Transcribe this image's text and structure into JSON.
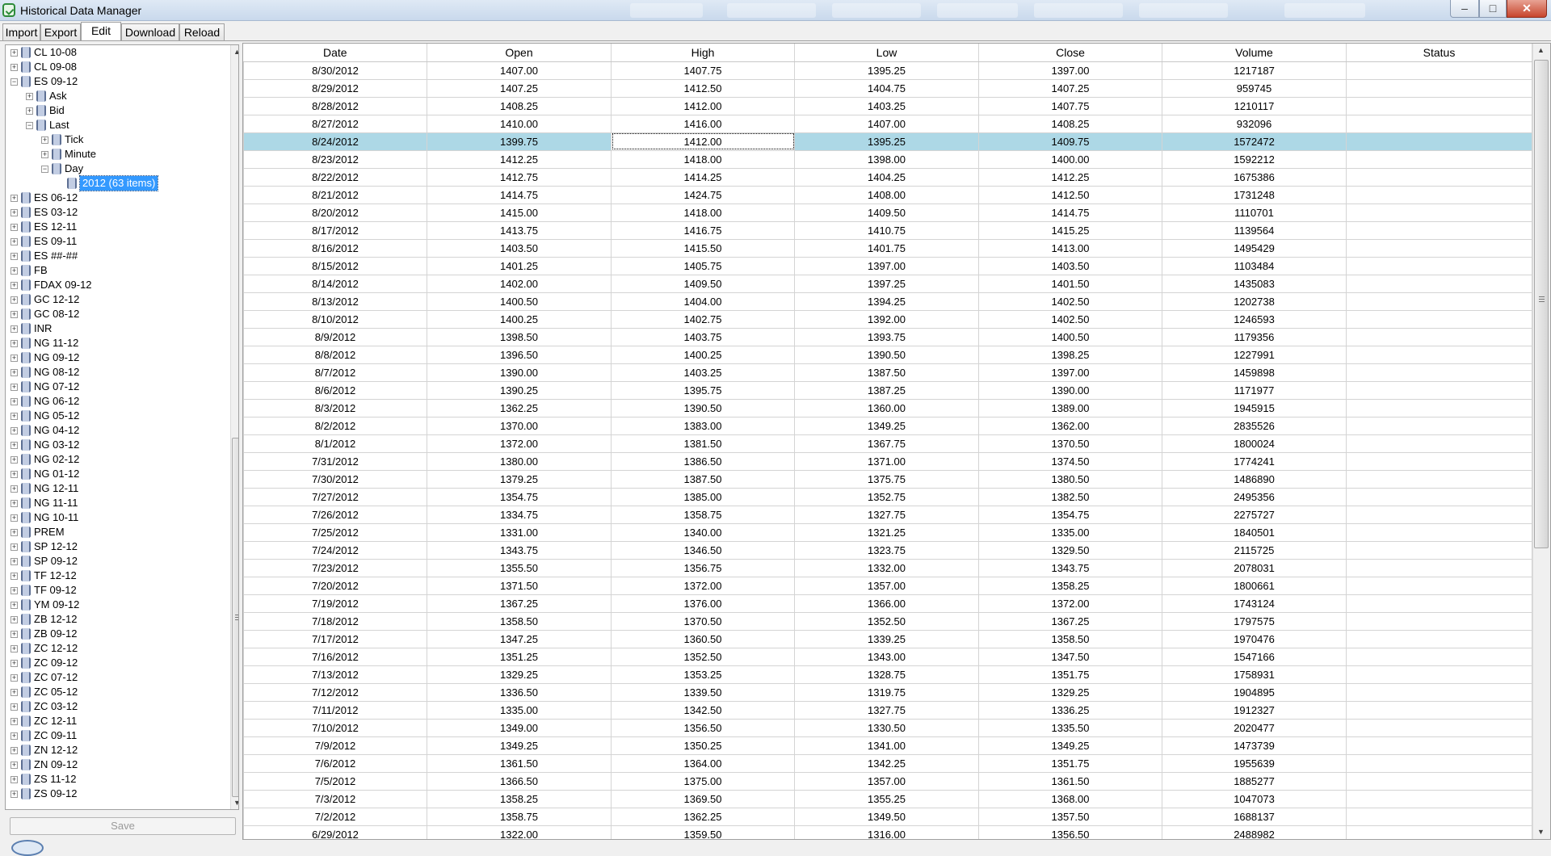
{
  "window": {
    "title": "Historical Data Manager",
    "min_glyph": "–",
    "max_glyph": "□",
    "close_glyph": "✕",
    "app_icon": "database-check-icon"
  },
  "tabs": [
    "Import",
    "Export",
    "Edit",
    "Download",
    "Reload"
  ],
  "active_tab": "Edit",
  "tree": {
    "rows": [
      {
        "label": "CL 10-08",
        "level": 0,
        "expander": "+"
      },
      {
        "label": "CL 09-08",
        "level": 0,
        "expander": "+"
      },
      {
        "label": "ES 09-12",
        "level": 0,
        "expander": "−"
      },
      {
        "label": "Ask",
        "level": 1,
        "expander": "+"
      },
      {
        "label": "Bid",
        "level": 1,
        "expander": "+"
      },
      {
        "label": "Last",
        "level": 1,
        "expander": "−"
      },
      {
        "label": "Tick",
        "level": 2,
        "expander": "+"
      },
      {
        "label": "Minute",
        "level": 2,
        "expander": "+"
      },
      {
        "label": "Day",
        "level": 2,
        "expander": "−"
      },
      {
        "label": "2012 (63 items)",
        "level": 3,
        "expander": "",
        "selected": true
      },
      {
        "label": "ES 06-12",
        "level": 0,
        "expander": "+"
      },
      {
        "label": "ES 03-12",
        "level": 0,
        "expander": "+"
      },
      {
        "label": "ES 12-11",
        "level": 0,
        "expander": "+"
      },
      {
        "label": "ES 09-11",
        "level": 0,
        "expander": "+"
      },
      {
        "label": "ES ##-##",
        "level": 0,
        "expander": "+"
      },
      {
        "label": "FB",
        "level": 0,
        "expander": "+"
      },
      {
        "label": "FDAX 09-12",
        "level": 0,
        "expander": "+"
      },
      {
        "label": "GC 12-12",
        "level": 0,
        "expander": "+"
      },
      {
        "label": "GC 08-12",
        "level": 0,
        "expander": "+"
      },
      {
        "label": "INR",
        "level": 0,
        "expander": "+"
      },
      {
        "label": "NG 11-12",
        "level": 0,
        "expander": "+"
      },
      {
        "label": "NG 09-12",
        "level": 0,
        "expander": "+"
      },
      {
        "label": "NG 08-12",
        "level": 0,
        "expander": "+"
      },
      {
        "label": "NG 07-12",
        "level": 0,
        "expander": "+"
      },
      {
        "label": "NG 06-12",
        "level": 0,
        "expander": "+"
      },
      {
        "label": "NG 05-12",
        "level": 0,
        "expander": "+"
      },
      {
        "label": "NG 04-12",
        "level": 0,
        "expander": "+"
      },
      {
        "label": "NG 03-12",
        "level": 0,
        "expander": "+"
      },
      {
        "label": "NG 02-12",
        "level": 0,
        "expander": "+"
      },
      {
        "label": "NG 01-12",
        "level": 0,
        "expander": "+"
      },
      {
        "label": "NG 12-11",
        "level": 0,
        "expander": "+"
      },
      {
        "label": "NG 11-11",
        "level": 0,
        "expander": "+"
      },
      {
        "label": "NG 10-11",
        "level": 0,
        "expander": "+"
      },
      {
        "label": "PREM",
        "level": 0,
        "expander": "+"
      },
      {
        "label": "SP 12-12",
        "level": 0,
        "expander": "+"
      },
      {
        "label": "SP 09-12",
        "level": 0,
        "expander": "+"
      },
      {
        "label": "TF 12-12",
        "level": 0,
        "expander": "+"
      },
      {
        "label": "TF 09-12",
        "level": 0,
        "expander": "+"
      },
      {
        "label": "YM 09-12",
        "level": 0,
        "expander": "+"
      },
      {
        "label": "ZB 12-12",
        "level": 0,
        "expander": "+"
      },
      {
        "label": "ZB 09-12",
        "level": 0,
        "expander": "+"
      },
      {
        "label": "ZC 12-12",
        "level": 0,
        "expander": "+"
      },
      {
        "label": "ZC 09-12",
        "level": 0,
        "expander": "+"
      },
      {
        "label": "ZC 07-12",
        "level": 0,
        "expander": "+"
      },
      {
        "label": "ZC 05-12",
        "level": 0,
        "expander": "+"
      },
      {
        "label": "ZC 03-12",
        "level": 0,
        "expander": "+"
      },
      {
        "label": "ZC 12-11",
        "level": 0,
        "expander": "+"
      },
      {
        "label": "ZC 09-11",
        "level": 0,
        "expander": "+"
      },
      {
        "label": "ZN 12-12",
        "level": 0,
        "expander": "+"
      },
      {
        "label": "ZN 09-12",
        "level": 0,
        "expander": "+"
      },
      {
        "label": "ZS 11-12",
        "level": 0,
        "expander": "+"
      },
      {
        "label": "ZS 09-12",
        "level": 0,
        "expander": "+"
      }
    ]
  },
  "save_label": "Save",
  "grid": {
    "columns": [
      "Date",
      "Open",
      "High",
      "Low",
      "Close",
      "Volume",
      "Status"
    ],
    "selected_row": 4,
    "focused_column": 2,
    "rows": [
      [
        "8/30/2012",
        "1407.00",
        "1407.75",
        "1395.25",
        "1397.00",
        "1217187",
        ""
      ],
      [
        "8/29/2012",
        "1407.25",
        "1412.50",
        "1404.75",
        "1407.25",
        "959745",
        ""
      ],
      [
        "8/28/2012",
        "1408.25",
        "1412.00",
        "1403.25",
        "1407.75",
        "1210117",
        ""
      ],
      [
        "8/27/2012",
        "1410.00",
        "1416.00",
        "1407.00",
        "1408.25",
        "932096",
        ""
      ],
      [
        "8/24/2012",
        "1399.75",
        "1412.00",
        "1395.25",
        "1409.75",
        "1572472",
        ""
      ],
      [
        "8/23/2012",
        "1412.25",
        "1418.00",
        "1398.00",
        "1400.00",
        "1592212",
        ""
      ],
      [
        "8/22/2012",
        "1412.75",
        "1414.25",
        "1404.25",
        "1412.25",
        "1675386",
        ""
      ],
      [
        "8/21/2012",
        "1414.75",
        "1424.75",
        "1408.00",
        "1412.50",
        "1731248",
        ""
      ],
      [
        "8/20/2012",
        "1415.00",
        "1418.00",
        "1409.50",
        "1414.75",
        "1110701",
        ""
      ],
      [
        "8/17/2012",
        "1413.75",
        "1416.75",
        "1410.75",
        "1415.25",
        "1139564",
        ""
      ],
      [
        "8/16/2012",
        "1403.50",
        "1415.50",
        "1401.75",
        "1413.00",
        "1495429",
        ""
      ],
      [
        "8/15/2012",
        "1401.25",
        "1405.75",
        "1397.00",
        "1403.50",
        "1103484",
        ""
      ],
      [
        "8/14/2012",
        "1402.00",
        "1409.50",
        "1397.25",
        "1401.50",
        "1435083",
        ""
      ],
      [
        "8/13/2012",
        "1400.50",
        "1404.00",
        "1394.25",
        "1402.50",
        "1202738",
        ""
      ],
      [
        "8/10/2012",
        "1400.25",
        "1402.75",
        "1392.00",
        "1402.50",
        "1246593",
        ""
      ],
      [
        "8/9/2012",
        "1398.50",
        "1403.75",
        "1393.75",
        "1400.50",
        "1179356",
        ""
      ],
      [
        "8/8/2012",
        "1396.50",
        "1400.25",
        "1390.50",
        "1398.25",
        "1227991",
        ""
      ],
      [
        "8/7/2012",
        "1390.00",
        "1403.25",
        "1387.50",
        "1397.00",
        "1459898",
        ""
      ],
      [
        "8/6/2012",
        "1390.25",
        "1395.75",
        "1387.25",
        "1390.00",
        "1171977",
        ""
      ],
      [
        "8/3/2012",
        "1362.25",
        "1390.50",
        "1360.00",
        "1389.00",
        "1945915",
        ""
      ],
      [
        "8/2/2012",
        "1370.00",
        "1383.00",
        "1349.25",
        "1362.00",
        "2835526",
        ""
      ],
      [
        "8/1/2012",
        "1372.00",
        "1381.50",
        "1367.75",
        "1370.50",
        "1800024",
        ""
      ],
      [
        "7/31/2012",
        "1380.00",
        "1386.50",
        "1371.00",
        "1374.50",
        "1774241",
        ""
      ],
      [
        "7/30/2012",
        "1379.25",
        "1387.50",
        "1375.75",
        "1380.50",
        "1486890",
        ""
      ],
      [
        "7/27/2012",
        "1354.75",
        "1385.00",
        "1352.75",
        "1382.50",
        "2495356",
        ""
      ],
      [
        "7/26/2012",
        "1334.75",
        "1358.75",
        "1327.75",
        "1354.75",
        "2275727",
        ""
      ],
      [
        "7/25/2012",
        "1331.00",
        "1340.00",
        "1321.25",
        "1335.00",
        "1840501",
        ""
      ],
      [
        "7/24/2012",
        "1343.75",
        "1346.50",
        "1323.75",
        "1329.50",
        "2115725",
        ""
      ],
      [
        "7/23/2012",
        "1355.50",
        "1356.75",
        "1332.00",
        "1343.75",
        "2078031",
        ""
      ],
      [
        "7/20/2012",
        "1371.50",
        "1372.00",
        "1357.00",
        "1358.25",
        "1800661",
        ""
      ],
      [
        "7/19/2012",
        "1367.25",
        "1376.00",
        "1366.00",
        "1372.00",
        "1743124",
        ""
      ],
      [
        "7/18/2012",
        "1358.50",
        "1370.50",
        "1352.50",
        "1367.25",
        "1797575",
        ""
      ],
      [
        "7/17/2012",
        "1347.25",
        "1360.50",
        "1339.25",
        "1358.50",
        "1970476",
        ""
      ],
      [
        "7/16/2012",
        "1351.25",
        "1352.50",
        "1343.00",
        "1347.50",
        "1547166",
        ""
      ],
      [
        "7/13/2012",
        "1329.25",
        "1353.25",
        "1328.75",
        "1351.75",
        "1758931",
        ""
      ],
      [
        "7/12/2012",
        "1336.50",
        "1339.50",
        "1319.75",
        "1329.25",
        "1904895",
        ""
      ],
      [
        "7/11/2012",
        "1335.00",
        "1342.50",
        "1327.75",
        "1336.25",
        "1912327",
        ""
      ],
      [
        "7/10/2012",
        "1349.00",
        "1356.50",
        "1330.50",
        "1335.50",
        "2020477",
        ""
      ],
      [
        "7/9/2012",
        "1349.25",
        "1350.25",
        "1341.00",
        "1349.25",
        "1473739",
        ""
      ],
      [
        "7/6/2012",
        "1361.50",
        "1364.00",
        "1342.25",
        "1351.75",
        "1955639",
        ""
      ],
      [
        "7/5/2012",
        "1366.50",
        "1375.00",
        "1357.00",
        "1361.50",
        "1885277",
        ""
      ],
      [
        "7/3/2012",
        "1358.25",
        "1369.50",
        "1355.25",
        "1368.00",
        "1047073",
        ""
      ],
      [
        "7/2/2012",
        "1358.75",
        "1362.25",
        "1349.50",
        "1357.50",
        "1688137",
        ""
      ],
      [
        "6/29/2012",
        "1322.00",
        "1359.50",
        "1316.00",
        "1356.50",
        "2488982",
        ""
      ]
    ]
  }
}
